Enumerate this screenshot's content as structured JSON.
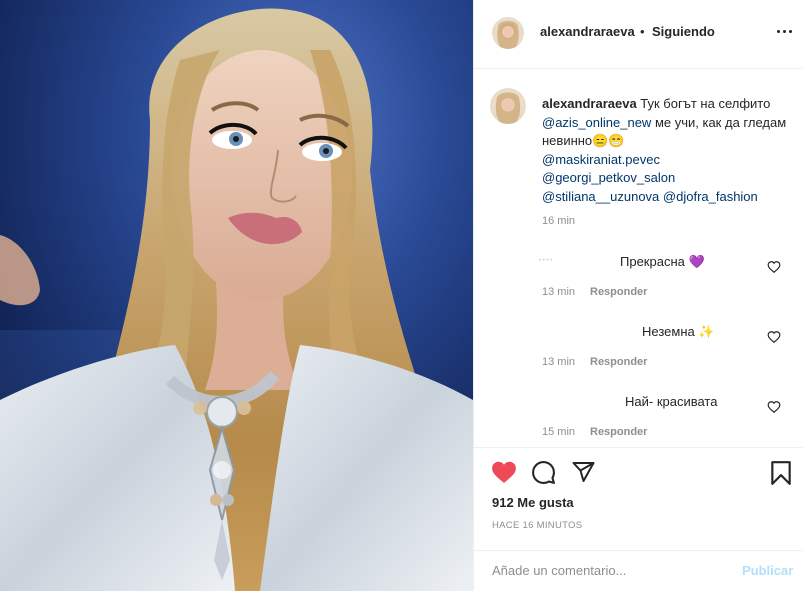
{
  "post": {
    "username": "alexandraraeva",
    "separator": "•",
    "follow_status": "Siguiendo",
    "more_icon": "more-horizontal-icon"
  },
  "caption": {
    "username": "alexandraraeva",
    "text_1": " Тук богът на селфито",
    "mention_1": "@azis_online_new",
    "text_2": " ме учи, как да гледам невинно",
    "emoji_1": "😑",
    "emoji_2": "😁",
    "mention_2": "@maskiraniat.pevec",
    "mention_3": "@georgi_petkov_salon",
    "mention_4": "@stiliana__uzunova",
    "mention_5": "@djofra_fashion",
    "time": "16 min"
  },
  "comments": [
    {
      "text": "Прекрасна",
      "emoji": "💜",
      "time": "13 min",
      "reply": "Responder"
    },
    {
      "text": "Неземна",
      "emoji": "✨",
      "time": "13 min",
      "reply": "Responder"
    },
    {
      "text": "Най- красивата",
      "emoji": "",
      "time": "15 min",
      "reply": "Responder"
    }
  ],
  "actions": {
    "likes": "912 Me gusta",
    "timestamp": "HACE 16 MINUTOS",
    "liked": true,
    "like_color": "#ed4956"
  },
  "add_comment": {
    "placeholder": "Añade un comentario...",
    "publish": "Publicar"
  }
}
